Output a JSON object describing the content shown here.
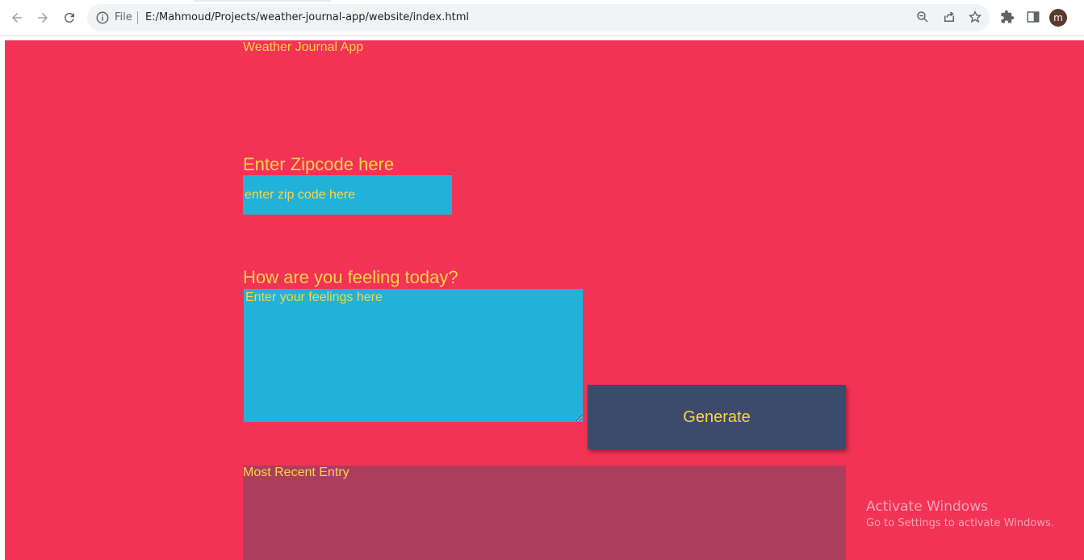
{
  "browser": {
    "file_label": "File",
    "url": "E:/Mahmoud/Projects/weather-journal-app/website/index.html",
    "profile_initial": "m",
    "icons": {
      "back": "arrow-left-icon",
      "forward": "arrow-right-icon",
      "reload": "reload-icon",
      "info": "info-icon",
      "zoom": "zoom-out-icon",
      "share": "share-icon",
      "bookmark": "star-icon",
      "extensions": "puzzle-icon",
      "side_panel": "side-panel-icon"
    }
  },
  "app": {
    "title": "Weather Journal App",
    "zip": {
      "label": "Enter Zipcode here",
      "placeholder": "enter zip code here",
      "value": ""
    },
    "feelings": {
      "label": "How are you feeling today?",
      "placeholder": "Enter your feelings here",
      "value": ""
    },
    "generate_label": "Generate",
    "recent_entry": {
      "title": "Most Recent Entry"
    }
  },
  "watermark": {
    "title": "Activate Windows",
    "subtitle": "Go to Settings to activate Windows."
  },
  "colors": {
    "page_background": "#f23356",
    "text_accent": "#f9d648",
    "input_background": "#22b2d8",
    "button_background": "#3c4a6b",
    "entry_background": "#ad3d5c"
  }
}
